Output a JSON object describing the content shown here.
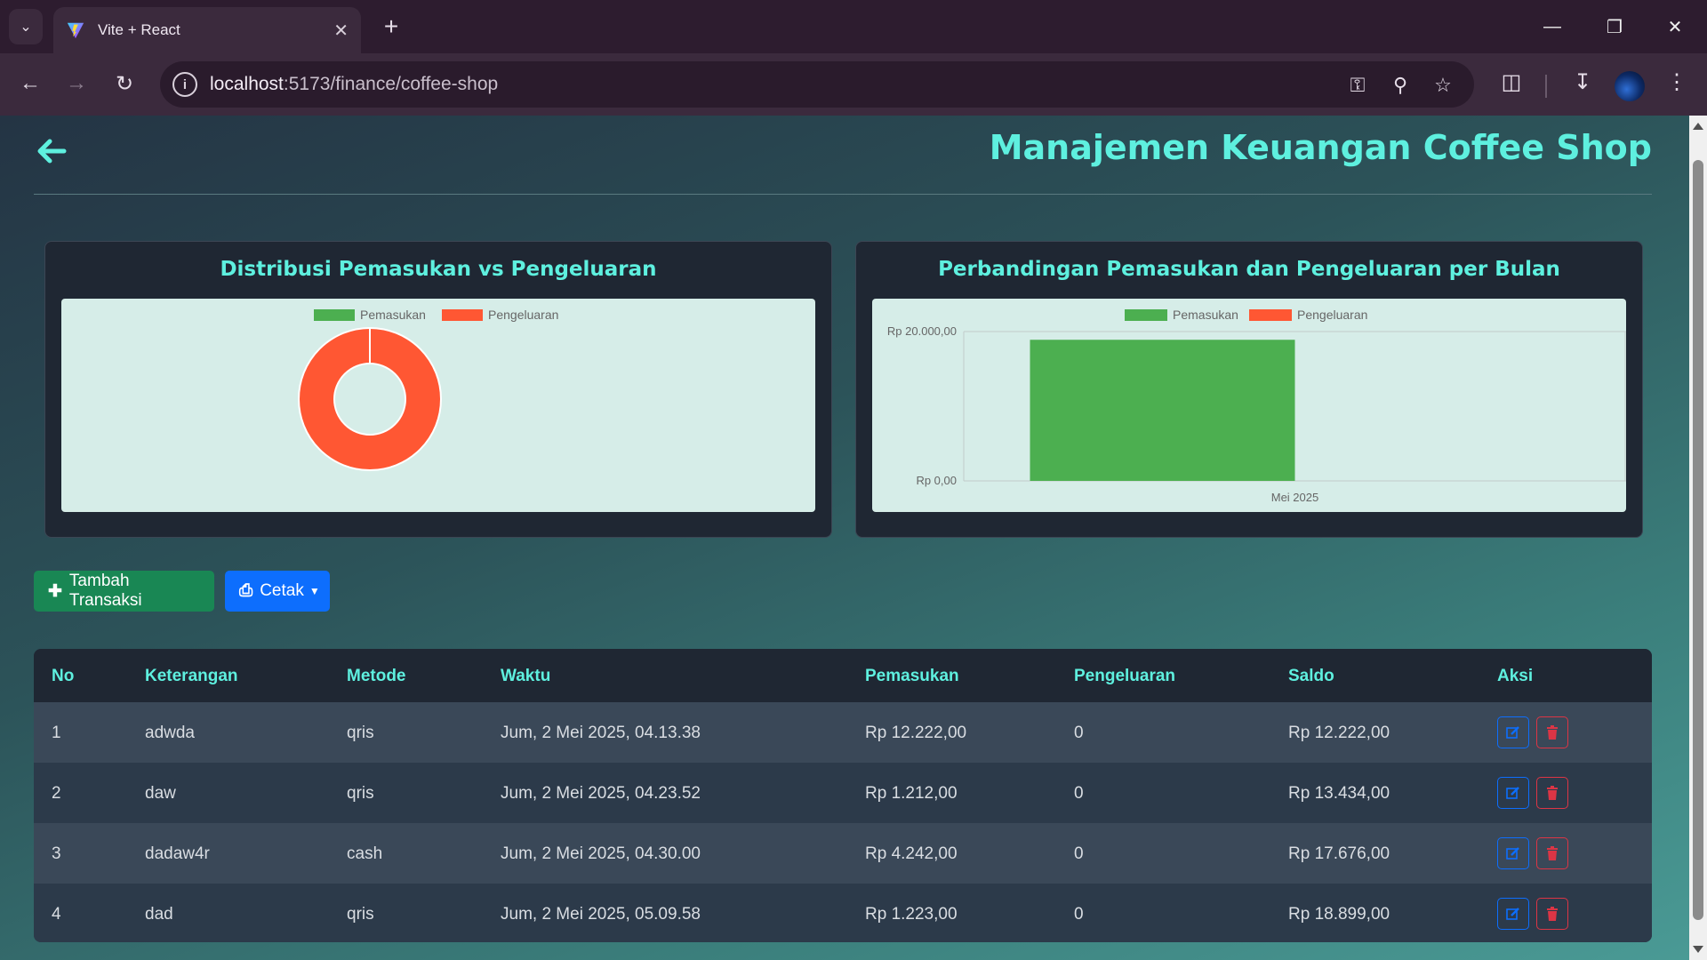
{
  "browser": {
    "tab_title": "Vite + React",
    "url_host": "localhost",
    "url_rest": ":5173/finance/coffee-shop"
  },
  "page": {
    "title": "Manajemen Keuangan Coffee Shop"
  },
  "charts": {
    "pie_title": "Distribusi Pemasukan vs Pengeluaran",
    "bar_title": "Perbandingan Pemasukan dan Pengeluaran per Bulan"
  },
  "chart_data": [
    {
      "type": "pie",
      "variant": "doughnut",
      "title": "Distribusi Pemasukan vs Pengeluaran",
      "legend": [
        "Pemasukan",
        "Pengeluaran"
      ],
      "legend_position": "top",
      "colors": [
        "#4caf50",
        "#ff5733"
      ],
      "values": [
        0,
        1
      ]
    },
    {
      "type": "bar",
      "title": "Perbandingan Pemasukan dan Pengeluaran per Bulan",
      "legend": [
        "Pemasukan",
        "Pengeluaran"
      ],
      "legend_position": "top",
      "categories": [
        "Mei 2025"
      ],
      "series": [
        {
          "name": "Pemasukan",
          "color": "#4caf50",
          "values": [
            18899
          ]
        },
        {
          "name": "Pengeluaran",
          "color": "#ff5733",
          "values": [
            0
          ]
        }
      ],
      "ylim": [
        0,
        20000
      ],
      "y_ticks": [
        "Rp 0,00",
        "Rp 20.000,00"
      ],
      "grid": true
    }
  ],
  "buttons": {
    "add": "Tambah Transaksi",
    "print": "Cetak"
  },
  "table": {
    "headers": [
      "No",
      "Keterangan",
      "Metode",
      "Waktu",
      "Pemasukan",
      "Pengeluaran",
      "Saldo",
      "Aksi"
    ],
    "rows": [
      {
        "no": "1",
        "keterangan": "adwda",
        "metode": "qris",
        "waktu": "Jum, 2 Mei 2025, 04.13.38",
        "pemasukan": "Rp 12.222,00",
        "pengeluaran": "0",
        "saldo": "Rp 12.222,00"
      },
      {
        "no": "2",
        "keterangan": "daw",
        "metode": "qris",
        "waktu": "Jum, 2 Mei 2025, 04.23.52",
        "pemasukan": "Rp 1.212,00",
        "pengeluaran": "0",
        "saldo": "Rp 13.434,00"
      },
      {
        "no": "3",
        "keterangan": "dadaw4r",
        "metode": "cash",
        "waktu": "Jum, 2 Mei 2025, 04.30.00",
        "pemasukan": "Rp 4.242,00",
        "pengeluaran": "0",
        "saldo": "Rp 17.676,00"
      },
      {
        "no": "4",
        "keterangan": "dad",
        "metode": "qris",
        "waktu": "Jum, 2 Mei 2025, 05.09.58",
        "pemasukan": "Rp 1.223,00",
        "pengeluaran": "0",
        "saldo": "Rp 18.899,00"
      }
    ]
  }
}
